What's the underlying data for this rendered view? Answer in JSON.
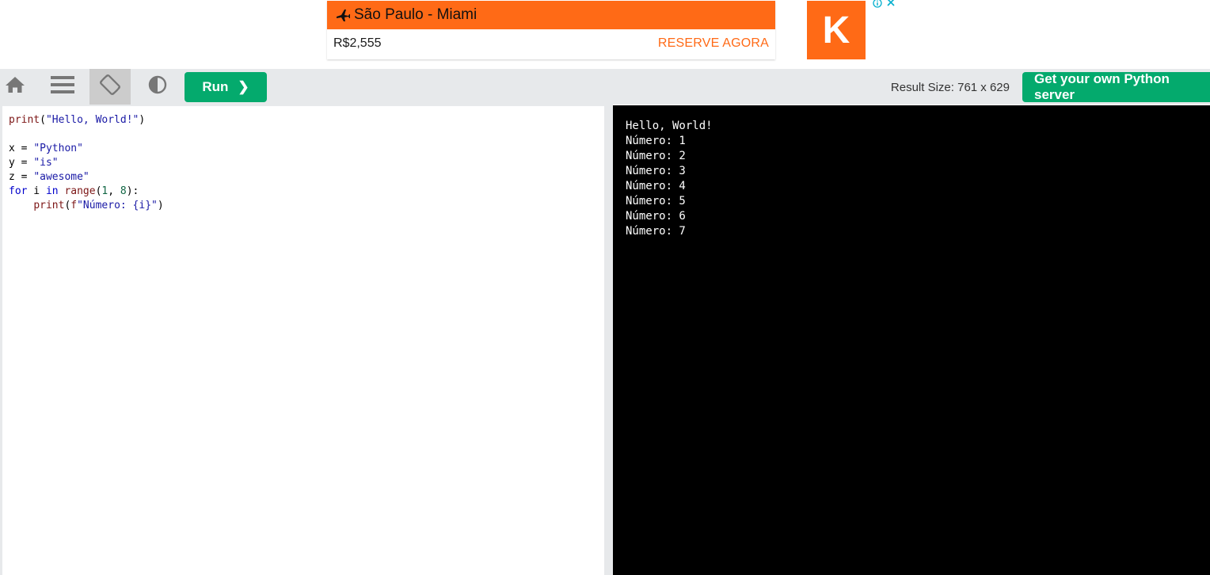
{
  "ad": {
    "route": "São Paulo - Miami",
    "price": "R$2,555",
    "cta": "RESERVE AGORA",
    "logo_letter": "K",
    "plane_icon": "airplane-icon",
    "info_icon": "info-icon",
    "close_icon": "close-icon"
  },
  "toolbar": {
    "home_icon": "home-icon",
    "menu_icon": "hamburger-menu-icon",
    "rotate_icon": "rotate-screen-icon",
    "theme_icon": "contrast-icon",
    "run_label": "Run",
    "run_chevron": "❯",
    "result_size": "Result Size: 761 x 629",
    "server_label": "Get your own Python server"
  },
  "editor": {
    "lines": [
      "print(\"Hello, World!\")",
      "",
      "x = \"Python\"",
      "y = \"is\"",
      "z = \"awesome\"",
      "for i in range(1, 8):",
      "    print(f\"Número: {i}\")"
    ]
  },
  "output": {
    "lines": [
      "Hello, World!",
      "Número: 1",
      "Número: 2",
      "Número: 3",
      "Número: 4",
      "Número: 5",
      "Número: 6",
      "Número: 7"
    ]
  },
  "colors": {
    "ad_orange": "#ff6a16",
    "run_green": "#04aa6d",
    "toolbar_bg": "#e7e9eb",
    "output_bg": "#000000"
  }
}
